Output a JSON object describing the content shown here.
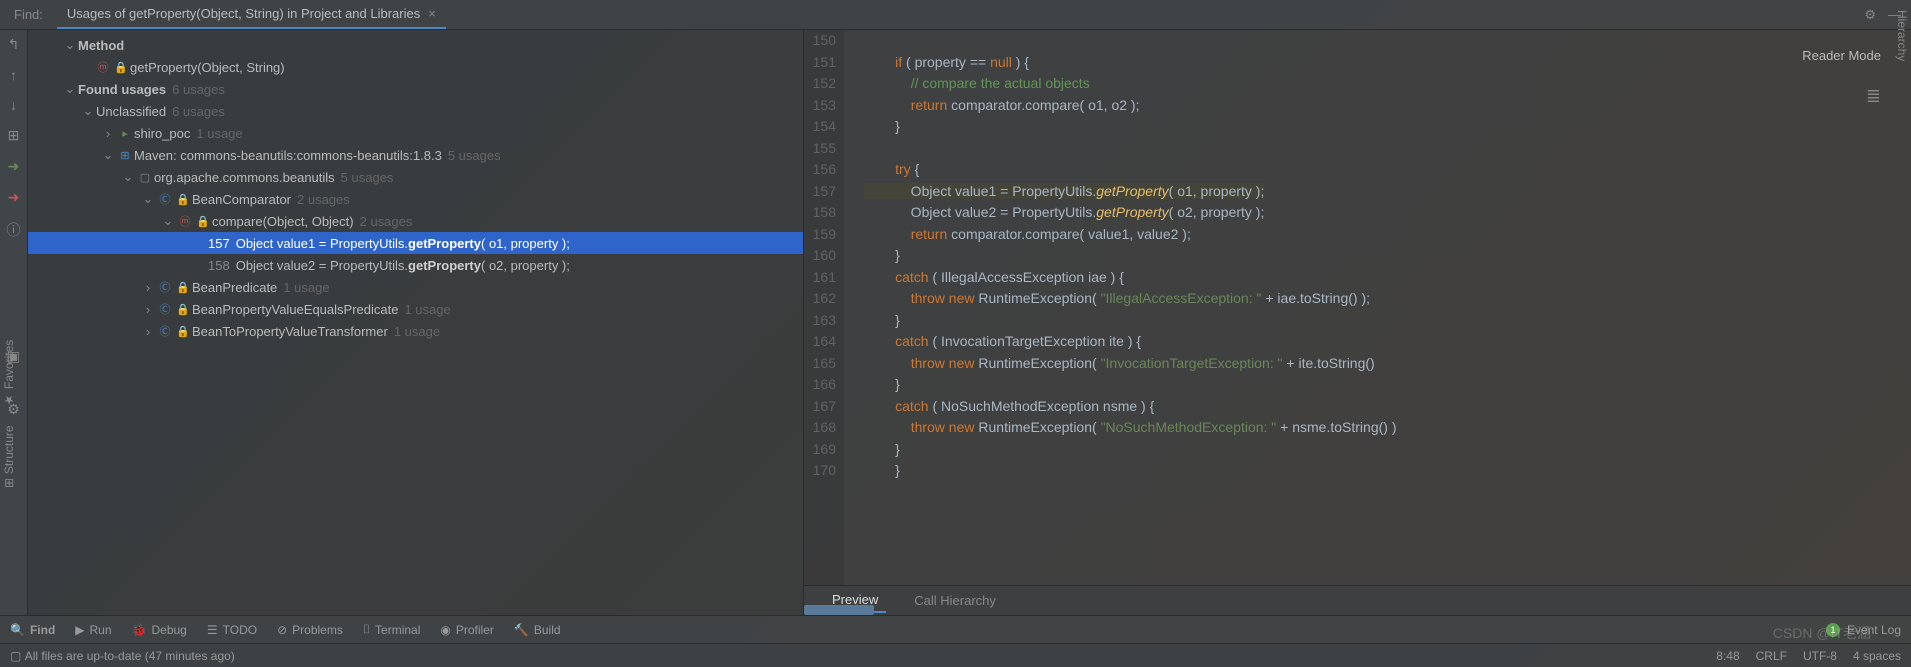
{
  "tab": {
    "find_label": "Find:",
    "title": "Usages of getProperty(Object, String) in Project and Libraries"
  },
  "reader_mode": "Reader Mode",
  "tree": {
    "method_header": "Method",
    "method_sig": "getProperty(Object, String)",
    "found_usages": "Found usages",
    "found_count": "6 usages",
    "unclassified": "Unclassified",
    "unclassified_count": "6 usages",
    "shiro": "shiro_poc",
    "shiro_count": "1 usage",
    "maven": "Maven: commons-beanutils:commons-beanutils:1.8.3",
    "maven_count": "5 usages",
    "pkg": "org.apache.commons.beanutils",
    "pkg_count": "5 usages",
    "comparator": "BeanComparator",
    "comparator_count": "2 usages",
    "compare": "compare(Object, Object)",
    "compare_count": "2 usages",
    "line157_ln": "157",
    "line157_a": "Object value1 = PropertyUtils.",
    "line157_b": "getProperty",
    "line157_c": "( o1, property );",
    "line158_ln": "158",
    "line158_a": "Object value2 = PropertyUtils.",
    "line158_b": "getProperty",
    "line158_c": "( o2, property );",
    "predicate": "BeanPredicate",
    "predicate_count": "1 usage",
    "prop_equals": "BeanPropertyValueEqualsPredicate",
    "prop_equals_count": "1 usage",
    "transformer": "BeanToPropertyValueTransformer",
    "transformer_count": "1 usage"
  },
  "gutter": [
    "150",
    "151",
    "152",
    "153",
    "154",
    "155",
    "156",
    "157",
    "158",
    "159",
    "160",
    "161",
    "162",
    "163",
    "164",
    "165",
    "166",
    "167",
    "168",
    "169",
    "170"
  ],
  "code_tabs": {
    "preview": "Preview",
    "hierarchy": "Call Hierarchy"
  },
  "bottom": {
    "find": "Find",
    "run": "Run",
    "debug": "Debug",
    "todo": "TODO",
    "problems": "Problems",
    "terminal": "Terminal",
    "profiler": "Profiler",
    "build": "Build",
    "eventlog": "Event Log"
  },
  "status": {
    "msg": "All files are up-to-date (47 minutes ago)",
    "pos": "8:48",
    "crlf": "CRLF",
    "enc": "UTF-8",
    "indent": "4 spaces"
  },
  "vtabs": {
    "favorites": "Favorites",
    "structure": "Structure",
    "hierarchy": "Hierarchy"
  },
  "watermark": "CSDN @IT老涵"
}
